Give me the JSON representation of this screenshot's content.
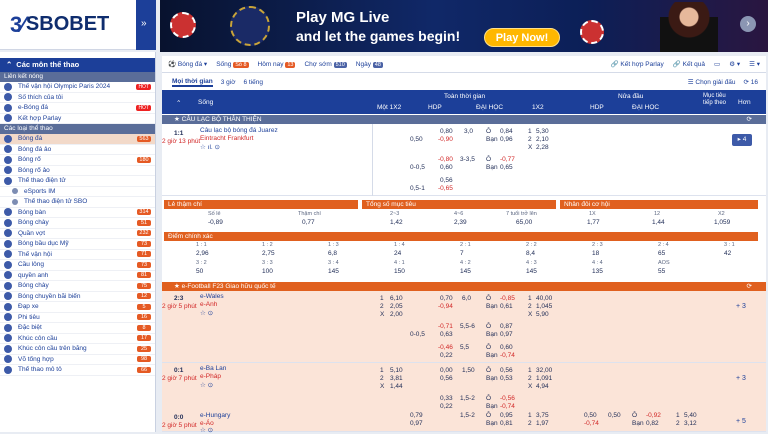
{
  "brand": {
    "name": "SBOBET"
  },
  "banner": {
    "line1": "Play MG Live",
    "line2": "and let the games begin!",
    "cta": "Play Now!"
  },
  "sidebar": {
    "header": "Các môn thể thao",
    "links_title": "Liên kết nóng",
    "links": [
      {
        "label": "Thế vận hội Olympic Paris 2024",
        "badge": "HOT"
      },
      {
        "label": "Số thích của tôi",
        "badge": ""
      },
      {
        "label": "e-Bóng đá",
        "badge": "HOT"
      },
      {
        "label": "Kết hợp Parlay",
        "badge": ""
      }
    ],
    "sports_title": "Các loại thể thao",
    "sports": [
      {
        "label": "Bóng đá",
        "count": "563",
        "selected": true
      },
      {
        "label": "Bóng đá ảo",
        "count": "",
        "selected": false
      },
      {
        "label": "Bóng rổ",
        "count": "180",
        "selected": false
      },
      {
        "label": "Bóng rổ ảo",
        "count": "",
        "selected": false
      },
      {
        "label": "Thể thao điện tử",
        "count": "",
        "selected": false
      },
      {
        "label": "eSports IM",
        "count": "",
        "selected": false,
        "indent": true
      },
      {
        "label": "Thể thao điện tử SBO",
        "count": "",
        "selected": false,
        "indent": true
      },
      {
        "label": "Bóng bàn",
        "count": "314",
        "selected": false
      },
      {
        "label": "Bóng chày",
        "count": "51",
        "selected": false
      },
      {
        "label": "Quần vợt",
        "count": "232",
        "selected": false
      },
      {
        "label": "Bóng bầu dục Mỹ",
        "count": "73",
        "selected": false
      },
      {
        "label": "Thế vận hội",
        "count": "71",
        "selected": false
      },
      {
        "label": "Cầu lông",
        "count": "73",
        "selected": false
      },
      {
        "label": "quyền anh",
        "count": "81",
        "selected": false
      },
      {
        "label": "Bóng chày",
        "count": "75",
        "selected": false
      },
      {
        "label": "Bóng chuyền bãi biển",
        "count": "12",
        "selected": false
      },
      {
        "label": "Đạp xe",
        "count": "5",
        "selected": false
      },
      {
        "label": "Phi tiêu",
        "count": "16",
        "selected": false
      },
      {
        "label": "Đặc biệt",
        "count": "8",
        "selected": false
      },
      {
        "label": "Khúc côn cầu",
        "count": "17",
        "selected": false
      },
      {
        "label": "Khúc côn cầu trên băng",
        "count": "25",
        "selected": false
      },
      {
        "label": "Võ tổng hợp",
        "count": "98",
        "selected": false
      },
      {
        "label": "Thể thao mô tô",
        "count": "66",
        "selected": false
      }
    ]
  },
  "topnav": {
    "sport": "Bóng đá",
    "live": "Sống",
    "live_count": "Số 8",
    "today": "Hôm nay",
    "today_count": "13",
    "early": "Chợ sớm",
    "early_count": "510",
    "day": "Ngày",
    "day_count": "48",
    "parlay": "Kết hợp Parlay",
    "results": "Kết quả"
  },
  "subnav": {
    "tabs": [
      "Mọi thời gian",
      "3 giờ",
      "6 tiếng"
    ],
    "choose": "Chọn giải đấu",
    "count": "16"
  },
  "table_head": {
    "live": "Sống",
    "fulltime": "Toàn thời gian",
    "halftime": "Nửa đầu",
    "x12": "Một 1X2",
    "hdp": "HDP",
    "ou": "ĐẠI HỌC",
    "x12b": "1X2",
    "hdp2": "HDP",
    "ou2": "ĐẠI HỌC",
    "top": "Mục tiêu tiếp theo",
    "more": "Hơn"
  },
  "section1": {
    "title": "CÂU LẠC BỘ THÂN THIỆN"
  },
  "match1": {
    "score": "1:1",
    "time": "2 giờ 13 phút",
    "home": "Câu lạc bộ bóng đá Juarez",
    "away": "Eintracht Frankfurt",
    "more": "4",
    "rows": [
      {
        "hdp_h": "0,80",
        "hdp_line": "3,0",
        "ou_label": "Ô",
        "ou_h": "0,84",
        "x": "1",
        "xv": "5,30"
      },
      {
        "hdp_line_a": "0,50",
        "hdp_a": "-0,90",
        "ou_label": "Bạn",
        "ou_a": "0,96",
        "x": "2",
        "xv": "2,10"
      },
      {
        "x": "X",
        "xv": "2,28"
      },
      {
        "hdp_h": "-0,80",
        "hdp_line": "3-3,5",
        "ou_label": "Ô",
        "ou_h": "-0,77"
      },
      {
        "hdp_line_a": "0-0,5",
        "hdp_a": "0,60",
        "ou_label": "Bạn",
        "ou_a": "0,65"
      },
      {
        "hdp_h": "0,56"
      },
      {
        "hdp_line_a": "0,5-1",
        "hdp_a": "-0,65"
      }
    ]
  },
  "panels": {
    "p1": {
      "title": "Lẻ thậm chí",
      "h1": "Số lẻ",
      "h2": "Thậm chí",
      "v1": "-0,89",
      "v2": "0,77"
    },
    "p2": {
      "title": "Tổng số mục tiêu",
      "h1": "2~3",
      "h2": "4~6",
      "h3": "7 tuổi trở lên",
      "v1": "1,42",
      "v2": "2,39",
      "v3": "65,00"
    },
    "p3": {
      "title": "Nhân đôi cơ hội",
      "h1": "1X",
      "h2": "12",
      "h3": "X2",
      "v1": "1,77",
      "v2": "1,44",
      "v3": "1,059"
    },
    "cs": {
      "title": "Điểm chính xác",
      "cells": [
        [
          "1 : 1",
          "2,96"
        ],
        [
          "1 : 2",
          "2,75"
        ],
        [
          "1 : 3",
          "6,8"
        ],
        [
          "1 : 4",
          "24"
        ],
        [
          "2 : 1",
          "7"
        ],
        [
          "2 : 2",
          "8,4"
        ],
        [
          "2 : 3",
          "18"
        ],
        [
          "2 : 4",
          "65"
        ],
        [
          "3 : 1",
          "42"
        ],
        [
          "3 : 2",
          "50"
        ],
        [
          "3 : 3",
          "100"
        ],
        [
          "3 : 4",
          "145"
        ],
        [
          "4 : 1",
          "150"
        ],
        [
          "4 : 2",
          "145"
        ],
        [
          "4 : 3",
          "145"
        ],
        [
          "4 : 4",
          "135"
        ],
        [
          "AOS",
          "55"
        ]
      ]
    }
  },
  "section2": {
    "title": "e-Football F23 Giao hữu quốc tế"
  },
  "match2": {
    "score": "2:3",
    "time": "2 giờ 5 phút",
    "home": "e-Wales",
    "away": "e-Anh",
    "l1": [
      "1",
      "6,10",
      "0,70",
      "6,0",
      "Ô",
      "-0,85",
      "1",
      "40,00"
    ],
    "l2": [
      "2",
      "2,05",
      "-0,94",
      "Bạn",
      "0,61",
      "2",
      "1,045"
    ],
    "l3": [
      "X",
      "2,00",
      "X",
      "5,90"
    ],
    "l4": [
      "-0,71",
      "5,5-6",
      "Ô",
      "0,87"
    ],
    "l5": [
      "0-0,5",
      "0,63",
      "Bạn",
      "0,97"
    ],
    "l6": [
      "-0,46",
      "5,5",
      "Ô",
      "0,60"
    ],
    "l7": [
      "0,22",
      "Bạn",
      "-0,74"
    ],
    "more": "3"
  },
  "match3": {
    "score": "0:1",
    "time": "2 giờ 7 phút",
    "home": "e-Ba Lan",
    "away": "e-Pháp",
    "l1": [
      "1",
      "5,10",
      "0,00",
      "1,50",
      "Ô",
      "0,56",
      "1",
      "32,00"
    ],
    "l2": [
      "2",
      "3,81",
      "0,56",
      "Bạn",
      "0,53",
      "2",
      "1,091"
    ],
    "l3": [
      "X",
      "1,44",
      "X",
      "4,94"
    ],
    "l4": [
      "0,33",
      "1,5-2",
      "Ô",
      "-0,56"
    ],
    "l5": [
      "0,22",
      "Bạn",
      "-0,74"
    ],
    "more": "3"
  },
  "match4": {
    "score": "0:0",
    "time": "2 giờ 5 phút",
    "home": "e-Hungary",
    "away": "e-Áo",
    "l1": [
      "0,79",
      "1,5-2",
      "Ô",
      "0,95",
      "1",
      "3,75",
      "0,50",
      "0,50",
      "Ô",
      "-0,92",
      "1",
      "5,40"
    ],
    "l2": [
      "0,97",
      "Bạn",
      "0,81",
      "2",
      "1,97",
      "-0,74",
      "Bạn",
      "0,82",
      "2",
      "3,12"
    ],
    "more": "5"
  }
}
